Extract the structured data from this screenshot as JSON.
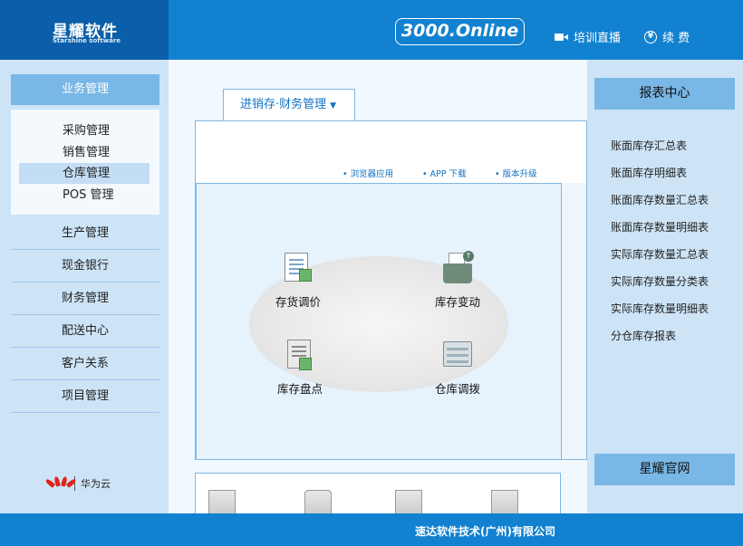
{
  "header": {
    "logo_cn": "星耀软件",
    "logo_en": "Starshine software",
    "brand": "3000.Online",
    "training_live": "培训直播",
    "renew": "续 费"
  },
  "left_sidebar": {
    "section_title": "业务管理",
    "sub_items": [
      "采购管理",
      "销售管理",
      "仓库管理",
      "POS 管理"
    ],
    "active_sub_item": "仓库管理",
    "menu": [
      "生产管理",
      "现金银行",
      "财务管理",
      "配送中心",
      "客户关系",
      "项目管理"
    ],
    "partner_label": "华为云",
    "partner_logo_text": "HUAWEI"
  },
  "main": {
    "tab_label": "进销存·财务管理",
    "tab_arrow": "▼",
    "quick_links": [
      "浏览器应用",
      "APP 下载",
      "版本升级"
    ],
    "functions": [
      {
        "label": "存货调价",
        "icon": "price-adjust-icon"
      },
      {
        "label": "库存变动",
        "icon": "inventory-change-icon"
      },
      {
        "label": "库存盘点",
        "icon": "stocktake-icon"
      },
      {
        "label": "仓库调拨",
        "icon": "warehouse-transfer-icon"
      }
    ]
  },
  "right_sidebar": {
    "title": "报表中心",
    "reports": [
      "账面库存汇总表",
      "账面库存明细表",
      "账面库存数量汇总表",
      "账面库存数量明细表",
      "实际库存数量汇总表",
      "实际库存数量分类表",
      "实际库存数量明细表",
      "分仓库存报表"
    ],
    "official_site": "星耀官网"
  },
  "footer": {
    "company": "速达软件技术(广州)有限公司"
  },
  "colors": {
    "header_blue": "#1282d0",
    "logo_blue": "#0b5ea9",
    "sidebar_bg": "#cde4f7",
    "accent_button": "#78b7e6",
    "link_blue": "#1572c1"
  }
}
